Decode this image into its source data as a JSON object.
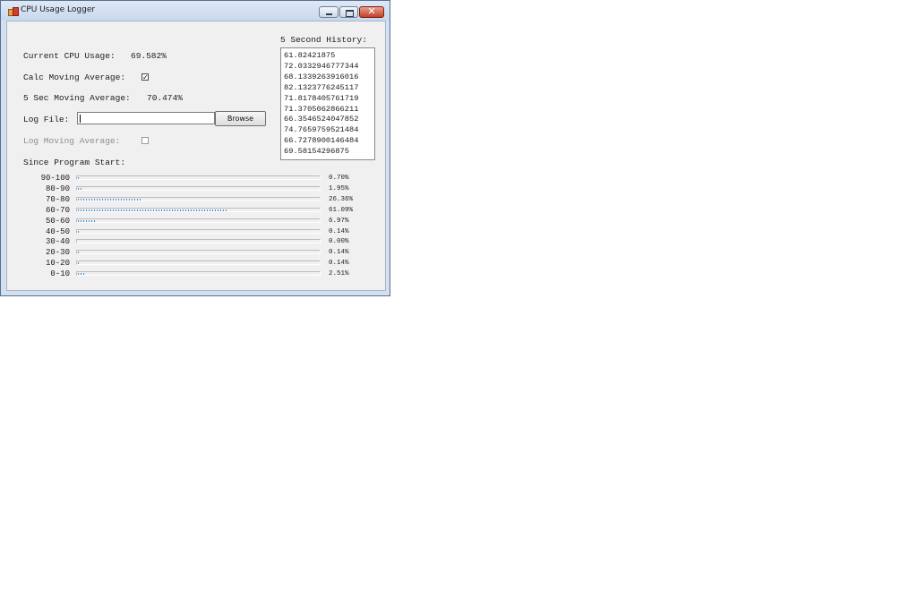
{
  "window": {
    "title": "CPU Usage Logger"
  },
  "stats": {
    "current_cpu_label": "Current CPU Usage:",
    "current_cpu_value": "69.582%",
    "calc_moving_avg_label": "Calc Moving Average:",
    "calc_moving_avg_checked": true,
    "moving_avg_label": "5 Sec Moving Average:",
    "moving_avg_value": "70.474%"
  },
  "logfile": {
    "label": "Log File:",
    "value": "",
    "browse_label": "Browse",
    "log_moving_avg_label": "Log Moving Average:",
    "log_moving_avg_checked": false
  },
  "history": {
    "title": "5 Second History:",
    "items": [
      "61.82421875",
      "72.0332946777344",
      "68.1339263916016",
      "82.1323776245117",
      "71.8178405761719",
      "71.3705062866211",
      "66.3546524047852",
      "74.7659759521484",
      "66.7278900146484",
      "69.58154296875"
    ]
  },
  "histogram": {
    "title": "Since Program Start:",
    "rows": [
      {
        "range": "90-100",
        "percent_text": "0.70%",
        "percent": 0.7
      },
      {
        "range": "80-90",
        "percent_text": "1.95%",
        "percent": 1.95
      },
      {
        "range": "70-80",
        "percent_text": "26.36%",
        "percent": 26.36
      },
      {
        "range": "60-70",
        "percent_text": "61.09%",
        "percent": 61.09
      },
      {
        "range": "50-60",
        "percent_text": "6.97%",
        "percent": 6.97
      },
      {
        "range": "40-50",
        "percent_text": "0.14%",
        "percent": 0.14
      },
      {
        "range": "30-40",
        "percent_text": "0.00%",
        "percent": 0.0
      },
      {
        "range": "20-30",
        "percent_text": "0.14%",
        "percent": 0.14
      },
      {
        "range": "10-20",
        "percent_text": "0.14%",
        "percent": 0.14
      },
      {
        "range": "0-10",
        "percent_text": "2.51%",
        "percent": 2.51
      }
    ]
  },
  "icons": {
    "app": "app-icon",
    "minimize": "minimize-icon",
    "maximize": "maximize-icon",
    "close": "close-icon"
  },
  "colors": {
    "progress_fill": "#3e8edb",
    "close_button": "#c4402a"
  }
}
